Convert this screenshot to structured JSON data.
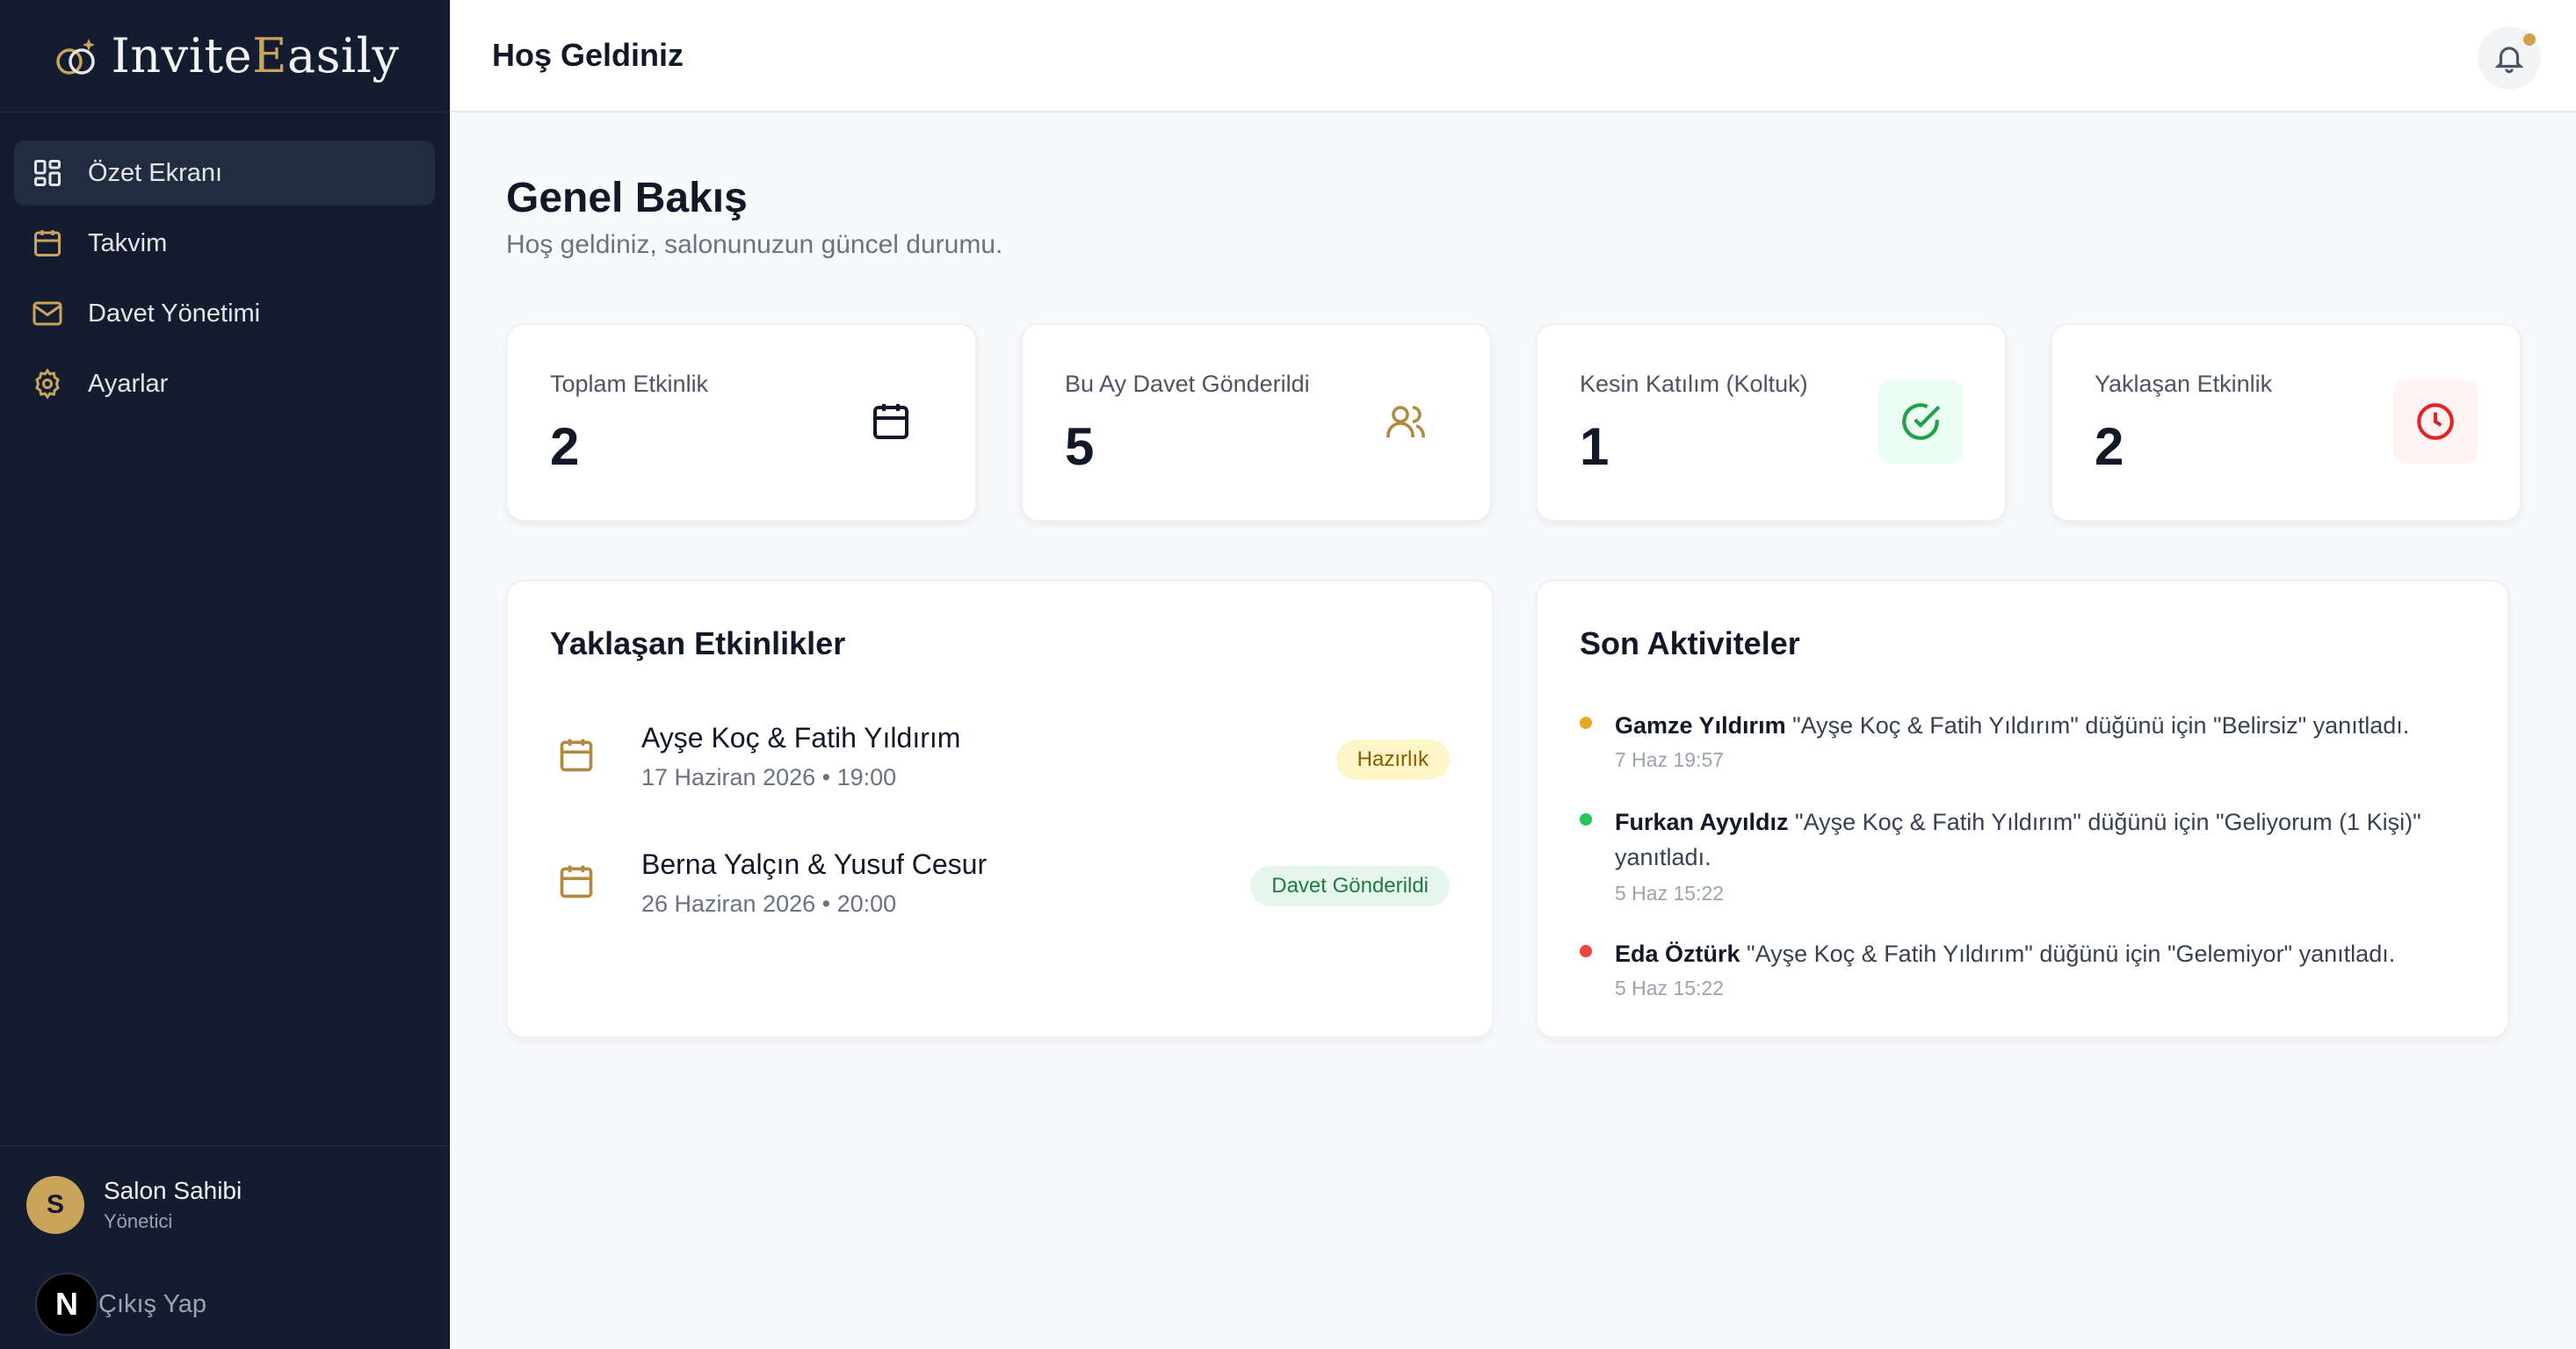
{
  "brand": {
    "name_part1": "Invite",
    "name_part2": "E",
    "name_part3": "asily",
    "accent": "#c9a45a"
  },
  "sidebar": {
    "items": [
      {
        "label": "Özet Ekranı",
        "icon": "dashboard-grid-icon",
        "active": true
      },
      {
        "label": "Takvim",
        "icon": "calendar-icon"
      },
      {
        "label": "Davet Yönetimi",
        "icon": "mail-icon"
      },
      {
        "label": "Ayarlar",
        "icon": "gear-icon"
      }
    ],
    "user": {
      "initial": "S",
      "name": "Salon Sahibi",
      "role": "Yönetici"
    },
    "logout_badge": "N",
    "logout_label": "Çıkış Yap"
  },
  "header": {
    "title": "Hoş Geldiniz",
    "bell_icon": "bell-icon"
  },
  "main": {
    "title": "Genel Bakış",
    "subtitle": "Hoş geldiniz, salonunuzun güncel durumu.",
    "stats": [
      {
        "label": "Toplam Etkinlik",
        "value": "2",
        "icon": "calendar-icon"
      },
      {
        "label": "Bu Ay Davet Gönderildi",
        "value": "5",
        "icon": "users-icon"
      },
      {
        "label": "Kesin Katılım (Koltuk)",
        "value": "1",
        "icon": "check-circle-icon"
      },
      {
        "label": "Yaklaşan Etkinlik",
        "value": "2",
        "icon": "clock-icon"
      }
    ],
    "upcoming": {
      "title": "Yaklaşan Etkinlikler",
      "events": [
        {
          "name": "Ayşe Koç & Fatih Yıldırım",
          "date": "17 Haziran 2026 • 19:00",
          "status": "Hazırlık"
        },
        {
          "name": "Berna Yalçın & Yusuf Cesur",
          "date": "26 Haziran 2026 • 20:00",
          "status": "Davet Gönderildi"
        }
      ]
    },
    "activities": {
      "title": "Son Aktiviteler",
      "items": [
        {
          "who": "Gamze Yıldırım",
          "text": " \"Ayşe Koç & Fatih Yıldırım\" düğünü için \"Belirsiz\" yanıtladı.",
          "time": "7 Haz 19:57",
          "color": "#e5a823"
        },
        {
          "who": "Furkan Ayyıldız",
          "text": " \"Ayşe Koç & Fatih Yıldırım\" düğünü için \"Geliyorum (1 Kişi)\" yanıtladı.",
          "time": "5 Haz 15:22",
          "color": "#22c55e"
        },
        {
          "who": "Eda Öztürk",
          "text": " \"Ayşe Koç & Fatih Yıldırım\" düğünü için \"Gelemiyor\" yanıtladı.",
          "time": "5 Haz 15:22",
          "color": "#ef4444"
        }
      ]
    }
  }
}
